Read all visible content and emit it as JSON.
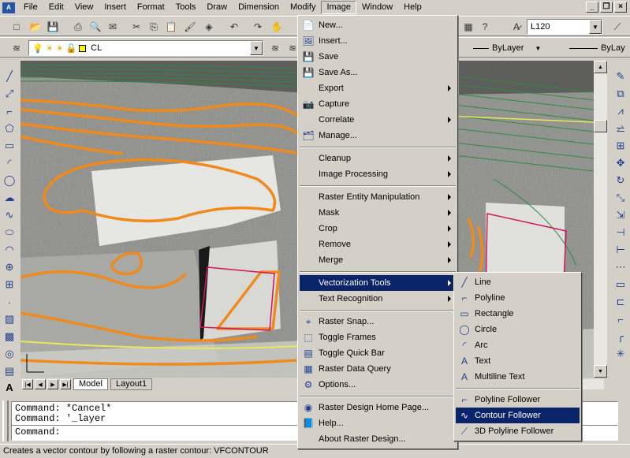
{
  "menubar": {
    "items": [
      "File",
      "Edit",
      "View",
      "Insert",
      "Format",
      "Tools",
      "Draw",
      "Dimension",
      "Modify",
      "Image",
      "Window",
      "Help"
    ],
    "active_index": 9
  },
  "toolbar": {
    "textstyle_value": "L120",
    "layer_value": "CL",
    "color_value": "ByLayer",
    "linetype_value": "ByLay"
  },
  "canvas": {
    "layout_tabs": [
      "Model",
      "Layout1"
    ],
    "active_tab": "Model"
  },
  "command": {
    "history": [
      "Command: *Cancel*",
      "Command: '_layer"
    ],
    "prompt": "Command:"
  },
  "status_text": "Creates a vector contour by following a raster contour: VFCONTOUR",
  "image_menu": [
    {
      "type": "item",
      "label": "New...",
      "icon": "new-icon"
    },
    {
      "type": "item",
      "label": "Insert...",
      "icon": "insert-icon"
    },
    {
      "type": "item",
      "label": "Save",
      "icon": "save-icon"
    },
    {
      "type": "item",
      "label": "Save As...",
      "icon": "save-as-icon"
    },
    {
      "type": "submenu",
      "label": "Export"
    },
    {
      "type": "item",
      "label": "Capture",
      "icon": "capture-icon"
    },
    {
      "type": "submenu",
      "label": "Correlate"
    },
    {
      "type": "item",
      "label": "Manage...",
      "icon": "manage-icon"
    },
    {
      "type": "sep"
    },
    {
      "type": "submenu",
      "label": "Cleanup"
    },
    {
      "type": "submenu",
      "label": "Image Processing"
    },
    {
      "type": "sep"
    },
    {
      "type": "submenu",
      "label": "Raster Entity Manipulation"
    },
    {
      "type": "submenu",
      "label": "Mask"
    },
    {
      "type": "submenu",
      "label": "Crop"
    },
    {
      "type": "submenu",
      "label": "Remove"
    },
    {
      "type": "submenu",
      "label": "Merge"
    },
    {
      "type": "sep"
    },
    {
      "type": "submenu",
      "label": "Vectorization Tools",
      "highlighted": true
    },
    {
      "type": "submenu",
      "label": "Text Recognition"
    },
    {
      "type": "sep"
    },
    {
      "type": "item",
      "label": "Raster Snap...",
      "icon": "raster-snap-icon"
    },
    {
      "type": "item",
      "label": "Toggle Frames",
      "icon": "toggle-frames-icon"
    },
    {
      "type": "item",
      "label": "Toggle Quick Bar",
      "icon": "toggle-quick-bar-icon"
    },
    {
      "type": "item",
      "label": "Raster Data Query",
      "icon": "raster-data-query-icon"
    },
    {
      "type": "item",
      "label": "Options...",
      "icon": "options-icon"
    },
    {
      "type": "sep"
    },
    {
      "type": "item",
      "label": "Raster Design Home Page...",
      "icon": "home-page-icon"
    },
    {
      "type": "item",
      "label": "Help...",
      "icon": "help-icon"
    },
    {
      "type": "item",
      "label": "About Raster Design..."
    }
  ],
  "vectorization_menu": [
    {
      "type": "item",
      "label": "Line",
      "icon": "line-icon"
    },
    {
      "type": "item",
      "label": "Polyline",
      "icon": "polyline-icon"
    },
    {
      "type": "item",
      "label": "Rectangle",
      "icon": "rectangle-icon"
    },
    {
      "type": "item",
      "label": "Circle",
      "icon": "circle-icon"
    },
    {
      "type": "item",
      "label": "Arc",
      "icon": "arc-icon"
    },
    {
      "type": "item",
      "label": "Text",
      "icon": "text-icon"
    },
    {
      "type": "item",
      "label": "Multiline Text",
      "icon": "multiline-text-icon"
    },
    {
      "type": "sep"
    },
    {
      "type": "item",
      "label": "Polyline Follower",
      "icon": "polyline-follower-icon"
    },
    {
      "type": "item",
      "label": "Contour Follower",
      "icon": "contour-follower-icon",
      "highlighted": true
    },
    {
      "type": "item",
      "label": "3D Polyline Follower",
      "icon": "3d-polyline-follower-icon"
    }
  ],
  "colors": {
    "contour": "#f08a1c",
    "green_contour": "#2e8b3e",
    "building_outline": "#d0165c",
    "highlight": "#0a246a"
  }
}
